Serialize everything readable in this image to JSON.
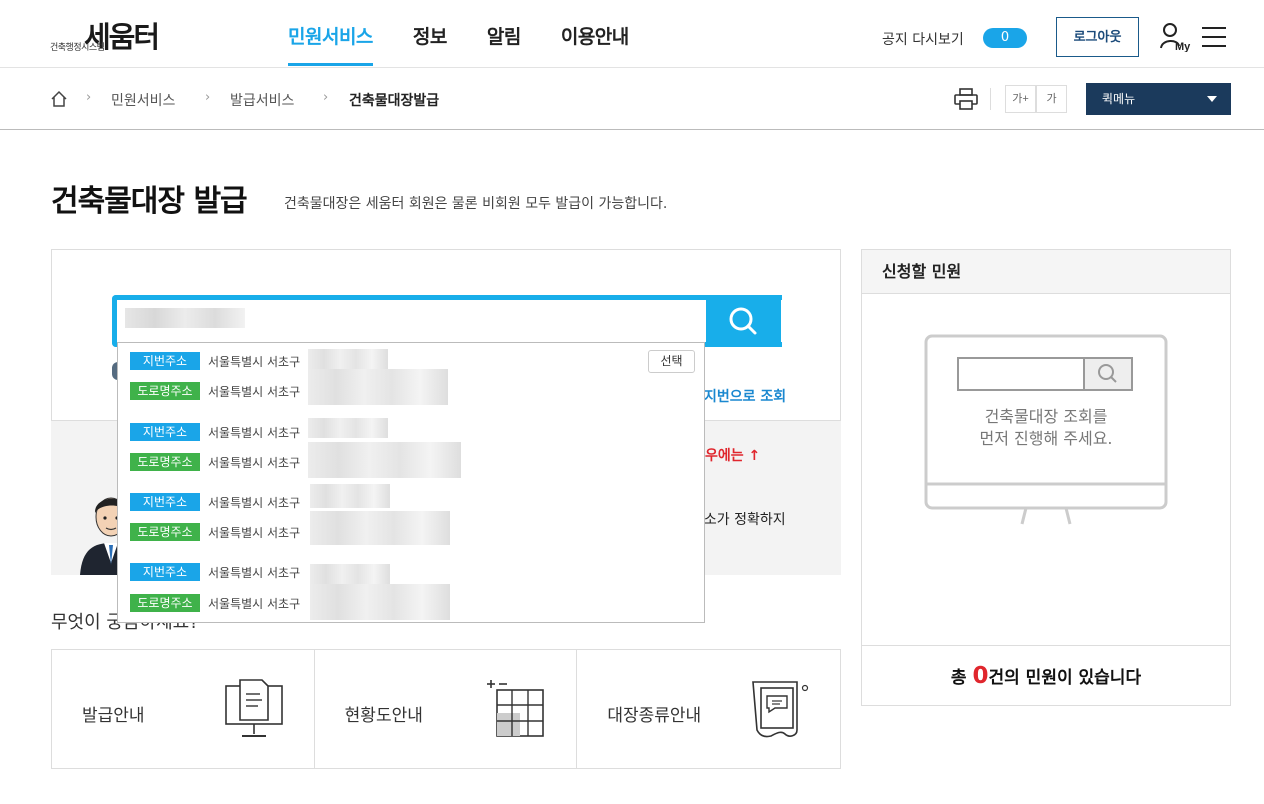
{
  "logo": {
    "sub": "건축행정시스템",
    "main": "세움터"
  },
  "gnb": {
    "items": [
      "민원서비스",
      "정보",
      "알림",
      "이용안내"
    ],
    "active": 0
  },
  "header": {
    "notice_label": "공지 다시보기",
    "notice_toggle": "0",
    "logout": "로그아웃",
    "my_label": "My"
  },
  "breadcrumb": {
    "items": [
      "민원서비스",
      "발급서비스",
      "건축물대장발급"
    ]
  },
  "tools": {
    "font_up": "가+",
    "font_down": "가",
    "quick_menu": "퀵메뉴"
  },
  "page": {
    "title": "건축물대장 발급",
    "desc": "건축물대장은 세움터 회원은 물론 비회원 모두 발급이 가능합니다."
  },
  "search": {
    "lot_link": "지번으로 조회",
    "info_red": "우에는 ↑",
    "info_text": "주소가 정확하지"
  },
  "autocomplete": {
    "select_label": "선택",
    "rows": [
      {
        "tag": "지번주소",
        "type": "lot",
        "addr": "서울특별시 서초구"
      },
      {
        "tag": "도로명주소",
        "type": "road",
        "addr": "서울특별시 서초구"
      },
      {
        "tag": "지번주소",
        "type": "lot",
        "addr": "서울특별시 서초구"
      },
      {
        "tag": "도로명주소",
        "type": "road",
        "addr": "서울특별시 서초구"
      },
      {
        "tag": "지번주소",
        "type": "lot",
        "addr": "서울특별시 서초구"
      },
      {
        "tag": "도로명주소",
        "type": "road",
        "addr": "서울특별시 서초구"
      },
      {
        "tag": "지번주소",
        "type": "lot",
        "addr": "서울특별시 서초구"
      },
      {
        "tag": "도로명주소",
        "type": "road",
        "addr": "서울특별시 서초구"
      }
    ]
  },
  "curious": "무엇이 궁금하세요?",
  "guides": [
    {
      "label": "발급안내",
      "icon": "document-monitor-icon"
    },
    {
      "label": "현황도안내",
      "icon": "floor-plan-grid-icon"
    },
    {
      "label": "대장종류안내",
      "icon": "scroll-document-icon"
    }
  ],
  "apply": {
    "title": "신청할 민원",
    "empty_line1": "건축물대장 조회를",
    "empty_line2": "먼저 진행해 주세요.",
    "foot_prefix": "총 ",
    "count": "0",
    "foot_suffix": "건의 민원이 있습니다"
  },
  "colors": {
    "accent": "#1aa5e8",
    "lot_tag": "#1aa5e8",
    "road_tag": "#3fb24a",
    "quick_menu_bg": "#1b3a5c",
    "alert_red": "#e0262d"
  }
}
